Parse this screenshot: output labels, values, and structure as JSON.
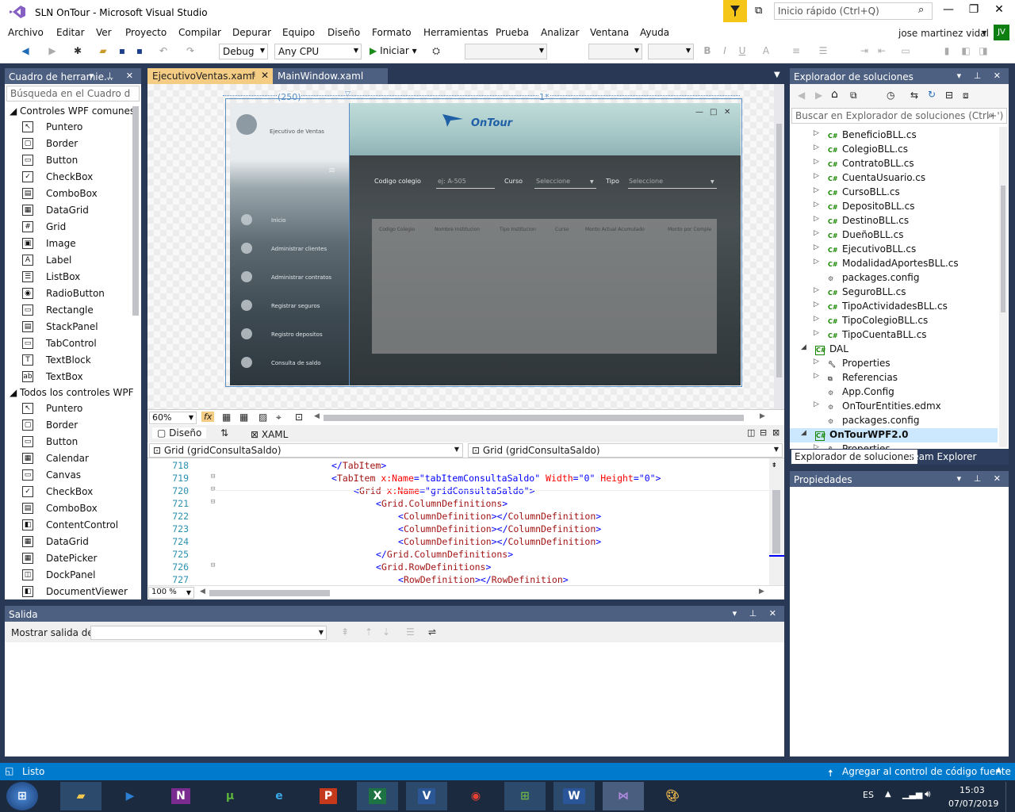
{
  "window": {
    "title": "SLN OnTour - Microsoft Visual Studio",
    "quick_launch": "Inicio rápido (Ctrl+Q)"
  },
  "menu": [
    "Archivo",
    "Editar",
    "Ver",
    "Proyecto",
    "Compilar",
    "Depurar",
    "Equipo",
    "Diseño",
    "Formato",
    "Herramientas",
    "Prueba",
    "Analizar",
    "Ventana",
    "Ayuda"
  ],
  "user": {
    "name": "jose martinez vidal",
    "initials": "JV"
  },
  "toolbar": {
    "config": "Debug",
    "platform": "Any CPU",
    "start": "Iniciar"
  },
  "toolbox": {
    "title": "Cuadro de herramie...",
    "search": "Búsqueda en el Cuadro d",
    "group1": "Controles WPF comunes",
    "group1_items": [
      "Puntero",
      "Border",
      "Button",
      "CheckBox",
      "ComboBox",
      "DataGrid",
      "Grid",
      "Image",
      "Label",
      "ListBox",
      "RadioButton",
      "Rectangle",
      "StackPanel",
      "TabControl",
      "TextBlock",
      "TextBox"
    ],
    "group2": "Todos los controles WPF",
    "group2_items": [
      "Puntero",
      "Border",
      "Button",
      "Calendar",
      "Canvas",
      "CheckBox",
      "ComboBox",
      "ContentControl",
      "DataGrid",
      "DatePicker",
      "DockPanel",
      "DocumentViewer"
    ]
  },
  "tabs": {
    "active": "EjecutivoVentas.xaml",
    "other": "MainWindow.xaml"
  },
  "designer": {
    "col1": "(250)",
    "col2": "1*",
    "app": {
      "brand": "OnTour",
      "role": "Ejecutivo de Ventas",
      "nav": [
        "Inicio",
        "Administrar clientes",
        "Administrar contratos",
        "Registrar seguros",
        "Registro depositos",
        "Consulta de saldo"
      ],
      "filter_label1": "Codigo colegio",
      "filter_placeholder1": "ej: A-505",
      "filter_label2": "Curso",
      "filter_placeholder2": "Seleccione",
      "filter_label3": "Tipo",
      "filter_placeholder3": "Seleccione",
      "columns": [
        "Codigo Colegio",
        "Nombre Institucion",
        "Tipo Institucion",
        "Curso",
        "Monto Actual Acumulado",
        "Monto por Comple"
      ]
    },
    "zoom": "60%",
    "view_design": "Diseño",
    "view_xaml": "XAML",
    "path_left": "Grid (gridConsultaSaldo)",
    "path_right": "Grid (gridConsultaSaldo)"
  },
  "code": {
    "lines": [
      {
        "n": "718",
        "indent": 4,
        "parts": [
          [
            "br",
            "</"
          ],
          [
            "tg",
            "TabItem"
          ],
          [
            "br",
            ">"
          ]
        ]
      },
      {
        "n": "719",
        "indent": 4,
        "parts": [
          [
            "br",
            "<"
          ],
          [
            "tg",
            "TabItem"
          ],
          [
            "at",
            " x:Name"
          ],
          [
            "br",
            "=\"tabItemConsultaSaldo\""
          ],
          [
            "at",
            " Width"
          ],
          [
            "br",
            "=\"0\""
          ],
          [
            "at",
            " Height"
          ],
          [
            "br",
            "=\"0\">"
          ]
        ]
      },
      {
        "n": "720",
        "indent": 8,
        "parts": [
          [
            "br",
            "<"
          ],
          [
            "tg",
            "Grid"
          ],
          [
            "at",
            " x:Name"
          ],
          [
            "br",
            "=\"gridConsultaSaldo\">"
          ]
        ]
      },
      {
        "n": "721",
        "indent": 12,
        "parts": [
          [
            "br",
            "<"
          ],
          [
            "tg",
            "Grid.ColumnDefinitions"
          ],
          [
            "br",
            ">"
          ]
        ]
      },
      {
        "n": "722",
        "indent": 16,
        "parts": [
          [
            "br",
            "<"
          ],
          [
            "tg",
            "ColumnDefinition"
          ],
          [
            "br",
            "></"
          ],
          [
            "tg",
            "ColumnDefinition"
          ],
          [
            "br",
            ">"
          ]
        ]
      },
      {
        "n": "723",
        "indent": 16,
        "parts": [
          [
            "br",
            "<"
          ],
          [
            "tg",
            "ColumnDefinition"
          ],
          [
            "br",
            "></"
          ],
          [
            "tg",
            "ColumnDefinition"
          ],
          [
            "br",
            ">"
          ]
        ]
      },
      {
        "n": "724",
        "indent": 16,
        "parts": [
          [
            "br",
            "<"
          ],
          [
            "tg",
            "ColumnDefinition"
          ],
          [
            "br",
            "></"
          ],
          [
            "tg",
            "ColumnDefinition"
          ],
          [
            "br",
            ">"
          ]
        ]
      },
      {
        "n": "725",
        "indent": 12,
        "parts": [
          [
            "br",
            "</"
          ],
          [
            "tg",
            "Grid.ColumnDefinitions"
          ],
          [
            "br",
            ">"
          ]
        ]
      },
      {
        "n": "726",
        "indent": 12,
        "parts": [
          [
            "br",
            "<"
          ],
          [
            "tg",
            "Grid.RowDefinitions"
          ],
          [
            "br",
            ">"
          ]
        ]
      },
      {
        "n": "727",
        "indent": 16,
        "parts": [
          [
            "br",
            "<"
          ],
          [
            "tg",
            "RowDefinition"
          ],
          [
            "br",
            "></"
          ],
          [
            "tg",
            "RowDefinition"
          ],
          [
            "br",
            ">"
          ]
        ]
      }
    ],
    "zoom": "100 %"
  },
  "output": {
    "title": "Salida",
    "show_label": "Mostrar salida de:"
  },
  "solution": {
    "title": "Explorador de soluciones",
    "search": "Buscar en Explorador de soluciones (Ctrl+')",
    "items": [
      {
        "t": "BeneficioBLL.cs",
        "k": "cs",
        "lv": 2
      },
      {
        "t": "ColegioBLL.cs",
        "k": "cs",
        "lv": 2
      },
      {
        "t": "ContratoBLL.cs",
        "k": "cs",
        "lv": 2
      },
      {
        "t": "CuentaUsuario.cs",
        "k": "cs",
        "lv": 2
      },
      {
        "t": "CursoBLL.cs",
        "k": "cs",
        "lv": 2
      },
      {
        "t": "DepositoBLL.cs",
        "k": "cs",
        "lv": 2
      },
      {
        "t": "DestinoBLL.cs",
        "k": "cs",
        "lv": 2
      },
      {
        "t": "DueñoBLL.cs",
        "k": "cs",
        "lv": 2
      },
      {
        "t": "EjecutivoBLL.cs",
        "k": "cs",
        "lv": 2
      },
      {
        "t": "ModalidadAportesBLL.cs",
        "k": "cs",
        "lv": 2
      },
      {
        "t": "packages.config",
        "k": "cfg",
        "lv": 2
      },
      {
        "t": "SeguroBLL.cs",
        "k": "cs",
        "lv": 2
      },
      {
        "t": "TipoActividadesBLL.cs",
        "k": "cs",
        "lv": 2
      },
      {
        "t": "TipoColegioBLL.cs",
        "k": "cs",
        "lv": 2
      },
      {
        "t": "TipoCuentaBLL.cs",
        "k": "cs",
        "lv": 2
      },
      {
        "t": "DAL",
        "k": "proj",
        "lv": 1
      },
      {
        "t": "Properties",
        "k": "wrench",
        "lv": 2
      },
      {
        "t": "Referencias",
        "k": "ref",
        "lv": 2
      },
      {
        "t": "App.Config",
        "k": "cfg",
        "lv": 2
      },
      {
        "t": "OnTourEntities.edmx",
        "k": "cfg",
        "lv": 2
      },
      {
        "t": "packages.config",
        "k": "cfg",
        "lv": 2
      },
      {
        "t": "OnTourWPF2.0",
        "k": "proj",
        "lv": 1
      },
      {
        "t": "Properties",
        "k": "wrench",
        "lv": 2
      }
    ],
    "tab1": "Explorador de soluciones",
    "tab2": "Team Explorer"
  },
  "properties": {
    "title": "Propiedades"
  },
  "status": {
    "left": "Listo",
    "right": "Agregar al control de código fuente"
  },
  "taskbar": {
    "lang": "ES",
    "time": "15:03",
    "date": "07/07/2019"
  }
}
